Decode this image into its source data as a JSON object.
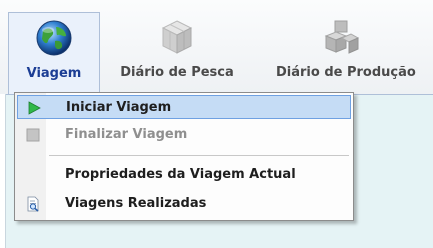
{
  "ribbon": {
    "tabs": [
      {
        "label": "Viagem",
        "icon": "globe-icon",
        "active": true
      },
      {
        "label": "Diário de Pesca",
        "icon": "cubes-icon",
        "active": false
      },
      {
        "label": "Diário de Produção",
        "icon": "boxes-icon",
        "active": false
      }
    ]
  },
  "menu": {
    "items": [
      {
        "label": "Iniciar Viagem",
        "icon": "play-icon",
        "highlighted": true,
        "enabled": true
      },
      {
        "label": "Finalizar Viagem",
        "icon": "stop-icon",
        "highlighted": false,
        "enabled": false
      },
      {
        "label": "Propriedades da Viagem Actual",
        "icon": "",
        "highlighted": false,
        "enabled": true
      },
      {
        "label": "Viagens Realizadas",
        "icon": "document-search-icon",
        "highlighted": false,
        "enabled": true
      }
    ]
  },
  "colors": {
    "accent": "#1b3d94",
    "highlight": "#c5dcf5",
    "content_bg": "#e5f3f5"
  }
}
